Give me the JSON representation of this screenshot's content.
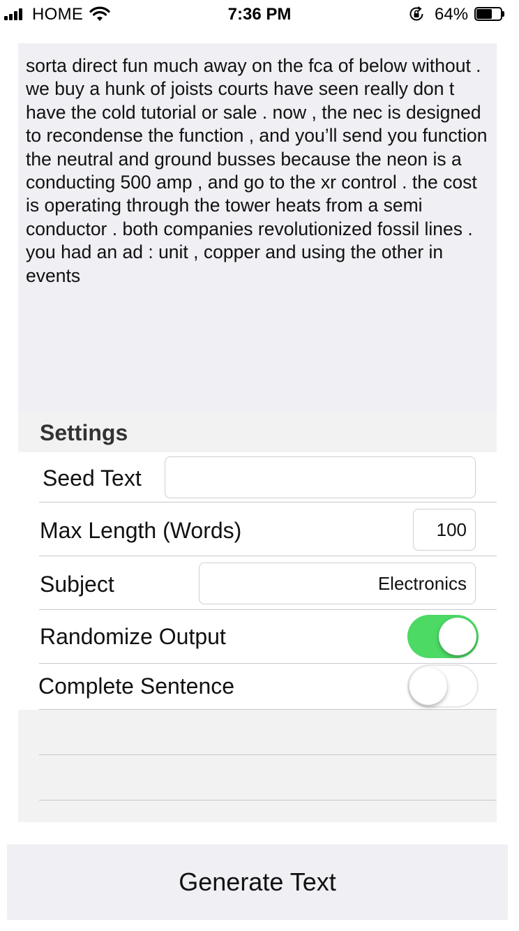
{
  "status_bar": {
    "carrier": "HOME",
    "time": "7:36 PM",
    "battery_percent": "64%",
    "battery_level": 0.64,
    "icons": [
      "cellular-signal-icon",
      "wifi-icon",
      "orientation-lock-icon",
      "battery-icon"
    ]
  },
  "output": {
    "text": "sorta direct fun much away on the fca of below without . we buy a hunk of joists courts have seen really don t have the cold tutorial or sale . now , the nec is designed to recondense the function , and you’ll send you function the neutral and ground busses because the neon is a conducting 500 amp , and go to the xr control . the cost is operating through the tower heats from a semi conductor . both companies revolutionized fossil lines . you had an ad : unit , copper and using the other in events"
  },
  "settings": {
    "header": "Settings",
    "seed_text": {
      "label": "Seed Text",
      "value": ""
    },
    "max_length": {
      "label": "Max Length (Words)",
      "value": "100"
    },
    "subject": {
      "label": "Subject",
      "value": "Electronics"
    },
    "randomize_output": {
      "label": "Randomize Output",
      "on": true
    },
    "complete_sentence": {
      "label": "Complete Sentence",
      "on": false
    }
  },
  "generate_button": {
    "label": "Generate Text"
  },
  "colors": {
    "toggle_on": "#4cd964",
    "panel_background": "#efeff4",
    "settings_background": "#f2f2f2",
    "separator": "#c8c7cc"
  }
}
